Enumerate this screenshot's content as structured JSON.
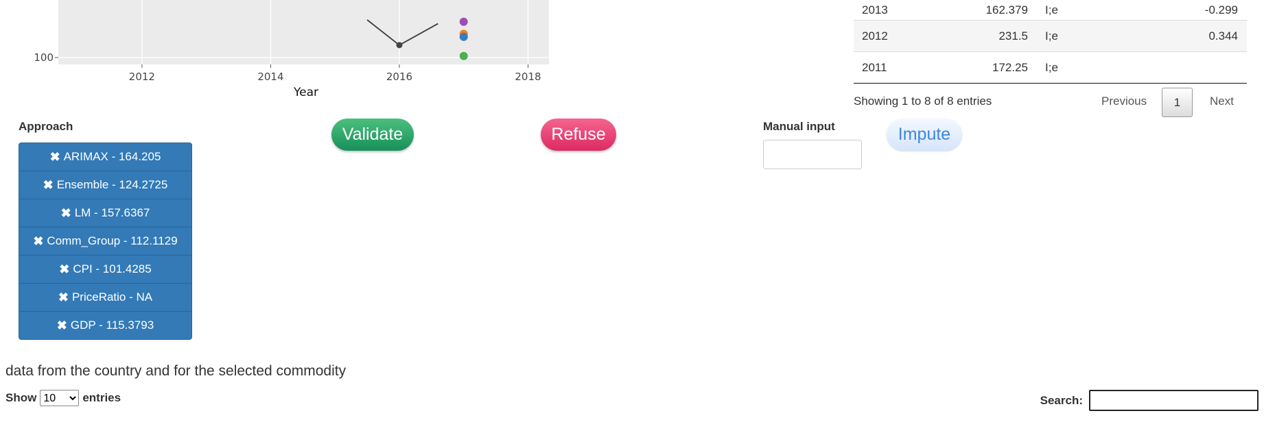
{
  "chart_data": {
    "type": "line",
    "xlabel": "Year",
    "x_ticks": [
      "2012",
      "2014",
      "2016",
      "2018"
    ],
    "y_ticks": [
      "100"
    ],
    "xlim": [
      2010.7,
      2018.4
    ],
    "ylim_visible_bottom": 100,
    "series": [
      {
        "x": [
          2015.5,
          2016,
          2016.6
        ],
        "y": [
          200,
          133,
          190
        ],
        "color": "#444444"
      }
    ],
    "points": [
      {
        "x": 2017,
        "y": 195,
        "color": "#9b4fb5"
      },
      {
        "x": 2017,
        "y": 163,
        "color": "#f47f20"
      },
      {
        "x": 2017,
        "y": 155,
        "color": "#3a7cc0"
      },
      {
        "x": 2017,
        "y": 104,
        "color": "#4caf50"
      }
    ]
  },
  "table_rows": [
    {
      "year": "2013",
      "value": "162.379",
      "flag": "I;e",
      "change": "-0.299"
    },
    {
      "year": "2012",
      "value": "231.5",
      "flag": "I;e",
      "change": "0.344"
    },
    {
      "year": "2011",
      "value": "172.25",
      "flag": "I;e",
      "change": ""
    }
  ],
  "table_info": "Showing 1 to 8 of 8 entries",
  "pager": {
    "previous": "Previous",
    "current": "1",
    "next": "Next"
  },
  "approach_label": "Approach",
  "approaches": [
    "ARIMAX - 164.205",
    "Ensemble - 124.2725",
    "LM - 157.6367",
    "Comm_Group - 112.1129",
    "CPI - 101.4285",
    "PriceRatio - NA",
    "GDP - 115.3793"
  ],
  "remove_glyph": "✖",
  "buttons": {
    "validate": "Validate",
    "refuse": "Refuse",
    "impute": "Impute"
  },
  "manual_input_label": "Manual input",
  "manual_input_value": "",
  "section_caption": "data from the country and for the selected commodity",
  "length": {
    "show": "Show",
    "selected": "10",
    "entries": "entries"
  },
  "search_label": "Search:",
  "search_value": "",
  "colors": {
    "approach_bg": "#337ab7",
    "validate": "#2aa36a",
    "refuse": "#e8467b",
    "impute_text": "#3d86da"
  }
}
